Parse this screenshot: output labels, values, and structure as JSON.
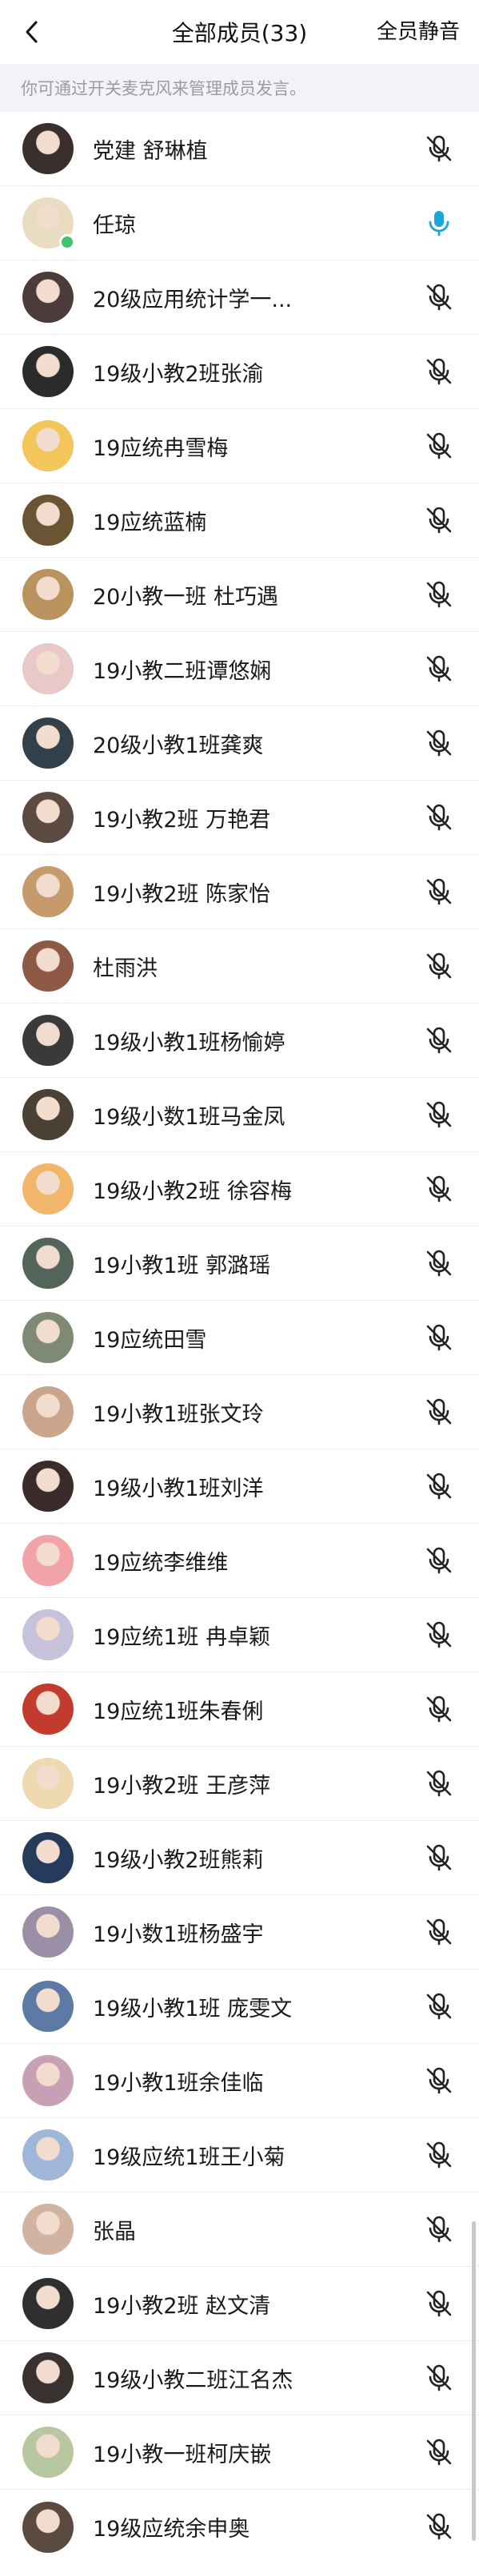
{
  "header": {
    "title": "全部成员(33)",
    "mute_all_label": "全员静音"
  },
  "notice": "你可通过开关麦克风来管理成员发言。",
  "colors": {
    "mic_active": "#1ba5d8",
    "mic_muted": "#222222",
    "online_badge": "#3fc36b",
    "notice_bg": "#f2f3f6"
  },
  "members": [
    {
      "name": "党建 舒琳植",
      "mic": "muted",
      "avatar_color": "#3a2f2c"
    },
    {
      "name": "任琼",
      "mic": "on",
      "avatar_color": "#e9dcc0",
      "online": true
    },
    {
      "name": "20级应用统计学一...",
      "mic": "muted",
      "avatar_color": "#4b3b3a"
    },
    {
      "name": "19级小教2班张渝",
      "mic": "muted",
      "avatar_color": "#2b2b2b"
    },
    {
      "name": "19应统冉雪梅",
      "mic": "muted",
      "avatar_color": "#f4c55a"
    },
    {
      "name": "19应统蓝楠",
      "mic": "muted",
      "avatar_color": "#6b5434"
    },
    {
      "name": "20小教一班 杜巧遇",
      "mic": "muted",
      "avatar_color": "#b9925e"
    },
    {
      "name": "19小教二班谭悠娴",
      "mic": "muted",
      "avatar_color": "#e8c9c8"
    },
    {
      "name": "20级小教1班龚爽",
      "mic": "muted",
      "avatar_color": "#33404a"
    },
    {
      "name": "19小教2班 万艳君",
      "mic": "muted",
      "avatar_color": "#5b4a42"
    },
    {
      "name": "19小教2班 陈家怡",
      "mic": "muted",
      "avatar_color": "#c79a6b"
    },
    {
      "name": "杜雨洪",
      "mic": "muted",
      "avatar_color": "#8e5a46"
    },
    {
      "name": "19级小教1班杨愉婷",
      "mic": "muted",
      "avatar_color": "#3a3a3a"
    },
    {
      "name": "19级小数1班马金凤",
      "mic": "muted",
      "avatar_color": "#4a4035"
    },
    {
      "name": "19级小教2班 徐容梅",
      "mic": "muted",
      "avatar_color": "#f2b66a"
    },
    {
      "name": "19小教1班 郭潞瑶",
      "mic": "muted",
      "avatar_color": "#53655a"
    },
    {
      "name": "19应统田雪",
      "mic": "muted",
      "avatar_color": "#7f8a75"
    },
    {
      "name": "19小教1班张文玲",
      "mic": "muted",
      "avatar_color": "#caa58c"
    },
    {
      "name": "19级小教1班刘洋",
      "mic": "muted",
      "avatar_color": "#3a2c2a"
    },
    {
      "name": "19应统李维维",
      "mic": "muted",
      "avatar_color": "#f2a3a8"
    },
    {
      "name": "19应统1班 冉卓颖",
      "mic": "muted",
      "avatar_color": "#c7c2dc"
    },
    {
      "name": "19应统1班朱春俐",
      "mic": "muted",
      "avatar_color": "#c33b2e"
    },
    {
      "name": "19小教2班 王彦萍",
      "mic": "muted",
      "avatar_color": "#efd9b0"
    },
    {
      "name": "19级小教2班熊莉",
      "mic": "muted",
      "avatar_color": "#263a5c"
    },
    {
      "name": "19小数1班杨盛宇",
      "mic": "muted",
      "avatar_color": "#9a8fa6"
    },
    {
      "name": "19级小教1班 庞雯文",
      "mic": "muted",
      "avatar_color": "#5d7aa4"
    },
    {
      "name": "19小教1班余佳临",
      "mic": "muted",
      "avatar_color": "#c7a0b6"
    },
    {
      "name": "19级应统1班王小菊",
      "mic": "muted",
      "avatar_color": "#9fb6d8"
    },
    {
      "name": "张晶",
      "mic": "muted",
      "avatar_color": "#d2b2a1"
    },
    {
      "name": "19小教2班 赵文清",
      "mic": "muted",
      "avatar_color": "#2f2f2f"
    },
    {
      "name": "19级小教二班江名杰",
      "mic": "muted",
      "avatar_color": "#3a3230"
    },
    {
      "name": "19小教一班柯庆嵌",
      "mic": "muted",
      "avatar_color": "#b7c7a0"
    },
    {
      "name": "19级应统余申奥",
      "mic": "muted",
      "avatar_color": "#5a4a3f"
    }
  ]
}
